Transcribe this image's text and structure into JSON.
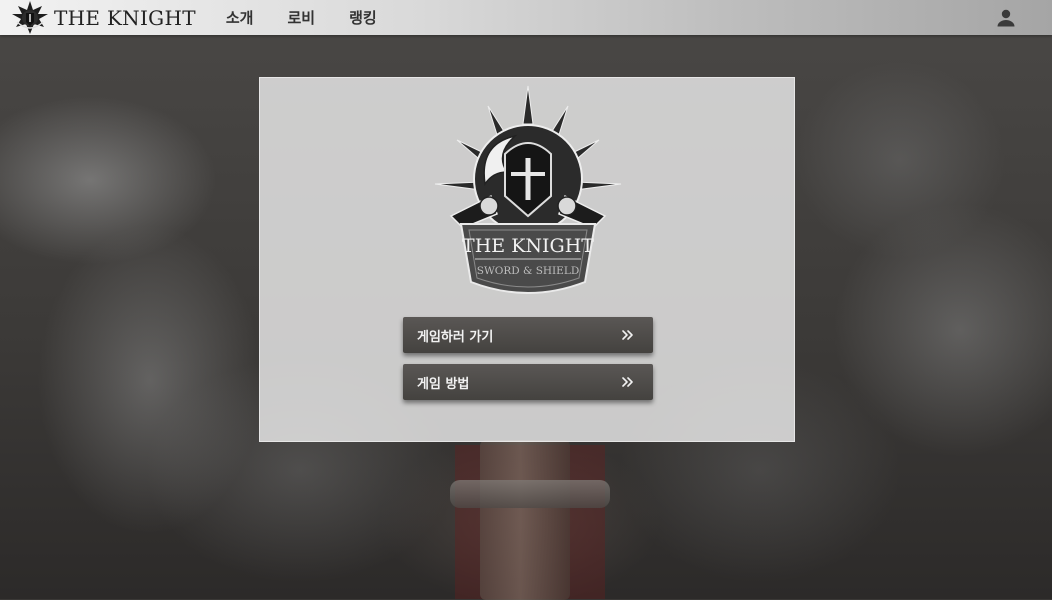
{
  "navbar": {
    "brand": "THE KNIGHT",
    "links": [
      {
        "label": "소개"
      },
      {
        "label": "로비"
      },
      {
        "label": "랭킹"
      }
    ],
    "user_icon": "person-icon"
  },
  "hero": {
    "logo_title": "THE KNIGHT",
    "logo_subtitle": "SWORD & SHIELD"
  },
  "actions": {
    "play_label": "게임하러 가기",
    "guide_label": "게임 방법",
    "arrow_icon": "double-chevron-right-icon"
  },
  "colors": {
    "button_bg": "#4e4b49",
    "panel_bg": "#ebebeb",
    "nav_left": "#f2f2f2",
    "nav_right": "#a5a5a5"
  }
}
